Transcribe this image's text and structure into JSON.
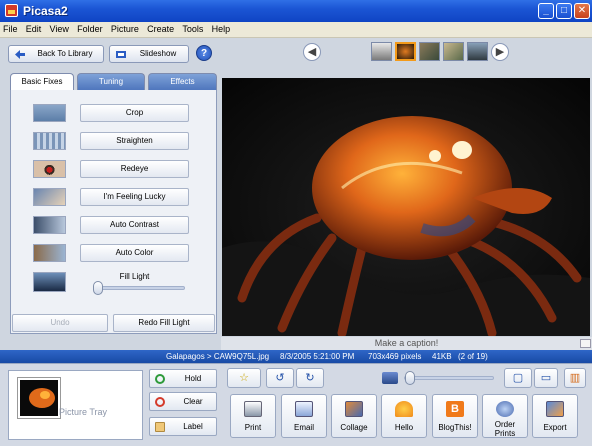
{
  "window": {
    "title": "Picasa2"
  },
  "menu": [
    "File",
    "Edit",
    "View",
    "Folder",
    "Picture",
    "Create",
    "Tools",
    "Help"
  ],
  "toolbar": {
    "back_label": "Back To Library",
    "slideshow_label": "Slideshow",
    "help_label": "?"
  },
  "tabs": [
    "Basic Fixes",
    "Tuning",
    "Effects"
  ],
  "fixes": [
    "Crop",
    "Straighten",
    "Redeye",
    "I'm Feeling Lucky",
    "Auto Contrast",
    "Auto Color"
  ],
  "fill_light": {
    "label": "Fill Light",
    "value": 0
  },
  "bottom": {
    "undo_label": "Undo",
    "redo_label": "Redo Fill Light"
  },
  "caption": {
    "placeholder": "Make a caption!"
  },
  "status": {
    "path": "Galapagos > CAW9Q75L.jpg",
    "date": "8/3/2005 5:21:00 PM",
    "dimensions": "703x469 pixels",
    "size": "41KB",
    "position": "(2 of 19)"
  },
  "tray": {
    "label": "Picture Tray",
    "hold_label": "Hold",
    "clear_label": "Clear",
    "label_label": "Label"
  },
  "actions": [
    "Print",
    "Email",
    "Collage",
    "Hello",
    "BlogThis!",
    "Order\nPrints",
    "Export"
  ],
  "colors": {
    "titlebar": "#1b55d4",
    "statusbar": "#184aa5",
    "selected_thumb": "#f39a1a"
  }
}
